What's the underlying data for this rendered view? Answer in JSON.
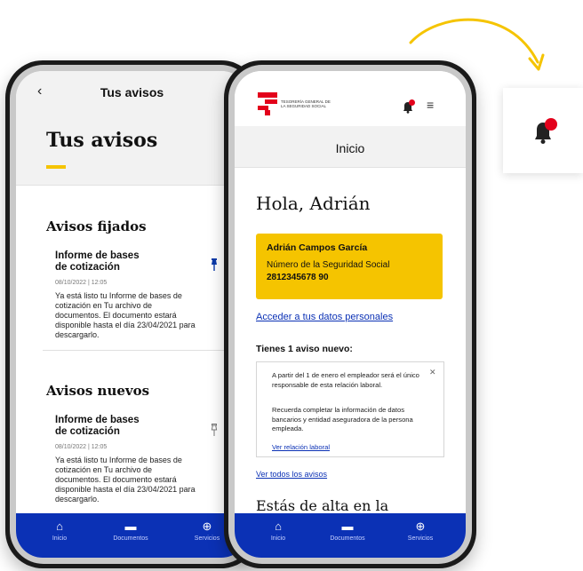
{
  "left_screen": {
    "back_icon": "chevron-left-icon",
    "topbar_title": "Tus avisos",
    "heading": "Tus avisos",
    "pinned_section": "Avisos fijados",
    "pinned_items": [
      {
        "title": "Informe de bases de cotización",
        "date": "08/10/2022 | 12:05",
        "body": "Ya está listo tu Informe de bases de cotización en Tu archivo de documentos. El documento estará disponible hasta el día 23/04/2021 para descargarlo."
      }
    ],
    "new_section": "Avisos nuevos",
    "new_items": [
      {
        "title": "Informe de bases de cotización",
        "date": "08/10/2022 | 12:05",
        "body": "Ya está listo tu Informe de bases de cotización en Tu archivo de documentos. El documento estará disponible hasta el día 23/04/2021 para descargarlo."
      }
    ],
    "nav": [
      "Inicio",
      "Documentos",
      "Servicios"
    ]
  },
  "right_screen": {
    "logo_text": "TESORERÍA GENERAL DE LA SEGURIDAD SOCIAL",
    "title": "Inicio",
    "greeting": "Hola, Adrián",
    "card": {
      "name": "Adrián Campos García",
      "label": "Número de la Seguridad Social",
      "number": "2812345678 90"
    },
    "link_data": "Acceder a tus datos personales",
    "new_notice_title": "Tienes 1 aviso nuevo:",
    "notice": {
      "p1": "A partir del 1 de enero el empleador será el único responsable de esta relación laboral.",
      "p2": "Recuerda completar la información de datos bancarios y entidad aseguradora de la persona empleada.",
      "link": "Ver relación laboral"
    },
    "link_all": "Ver todos los avisos",
    "alta": "Estás de alta en la",
    "nav": [
      "Inicio",
      "Documentos",
      "Servicios"
    ]
  },
  "colors": {
    "brand_blue": "#0b31b5",
    "accent_yellow": "#f5c400",
    "alert_red": "#e3001b"
  },
  "icons": [
    "chevron-left-icon",
    "pin-icon",
    "bell-icon",
    "menu-icon",
    "home-icon",
    "folder-icon",
    "globe-icon",
    "close-icon"
  ]
}
